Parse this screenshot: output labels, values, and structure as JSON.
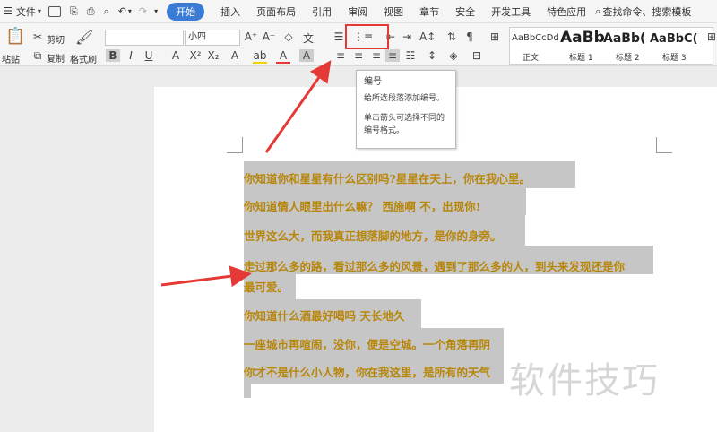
{
  "menubar": {
    "file": "文件",
    "tabs": [
      "开始",
      "插入",
      "页面布局",
      "引用",
      "审阅",
      "视图",
      "章节",
      "安全",
      "开发工具",
      "特色应用"
    ],
    "search": "查找命令、搜索模板"
  },
  "ribbon": {
    "paste": "粘贴",
    "cut": "剪切",
    "copy": "复制",
    "format_painter": "格式刷",
    "font_name": "",
    "font_size": "小四",
    "styles": [
      {
        "preview": "AaBbCcDd",
        "label": "正文"
      },
      {
        "preview": "AaBb",
        "label": "标题 1"
      },
      {
        "preview": "AaBb(",
        "label": "标题 2"
      },
      {
        "preview": "AaBbC(",
        "label": "标题 3"
      }
    ]
  },
  "tooltip": {
    "title": "编号",
    "line1": "给所选段落添加编号。",
    "line2": "单击箭头可选择不同的编号格式。"
  },
  "document": {
    "paragraphs": [
      "你知道你和星星有什么区别吗?星星在天上，你在我心里。",
      "你知道情人眼里出什么嘛？ 西施啊  不，出现你!",
      "世界这么大，而我真正想落脚的地方，是你的身旁。",
      "走过那么多的路，看过那么多的风景，遇到了那么多的人，到头来发现还是你",
      "最可爱。",
      "你知道什么酒最好喝吗  天长地久",
      "一座城市再喧闹，没你，便是空城。一个角落再阴",
      "你才不是什么小人物，你在我这里，是所有的天气"
    ]
  },
  "watermark": "软件技巧",
  "colors": {
    "accent": "#3a7bd5",
    "text": "#b8860b",
    "highlight": "#e53935"
  }
}
